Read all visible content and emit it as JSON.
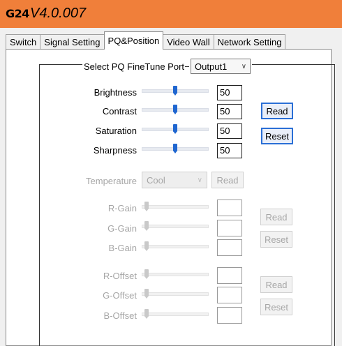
{
  "window": {
    "logo": "G24",
    "version": "V4.0.007",
    "title_bg": "#f07f3a"
  },
  "tabs": [
    {
      "label": "Switch",
      "active": false
    },
    {
      "label": "Signal Setting",
      "active": false
    },
    {
      "label": "PQ&Position",
      "active": true
    },
    {
      "label": "Video Wall",
      "active": false
    },
    {
      "label": "Network Setting",
      "active": false
    }
  ],
  "pq": {
    "group_label": "Select PQ FineTune Port",
    "port_value": "Output1",
    "sliders": [
      {
        "label": "Brightness",
        "value": "50",
        "level": 50
      },
      {
        "label": "Contrast",
        "value": "50",
        "level": 50
      },
      {
        "label": "Saturation",
        "value": "50",
        "level": 50
      },
      {
        "label": "Sharpness",
        "value": "50",
        "level": 50
      }
    ],
    "read_label": "Read",
    "reset_label": "Reset"
  },
  "temperature": {
    "label": "Temperature",
    "value": "Cool",
    "read_label": "Read"
  },
  "gain": {
    "sliders": [
      {
        "label": "R-Gain"
      },
      {
        "label": "G-Gain"
      },
      {
        "label": "B-Gain"
      }
    ],
    "read_label": "Read",
    "reset_label": "Reset"
  },
  "offset": {
    "sliders": [
      {
        "label": "R-Offset"
      },
      {
        "label": "G-Offset"
      },
      {
        "label": "B-Offset"
      }
    ],
    "read_label": "Read",
    "reset_label": "Reset"
  },
  "colors": {
    "accent": "#1f66d0",
    "disabled_text": "#a6a6a6"
  }
}
